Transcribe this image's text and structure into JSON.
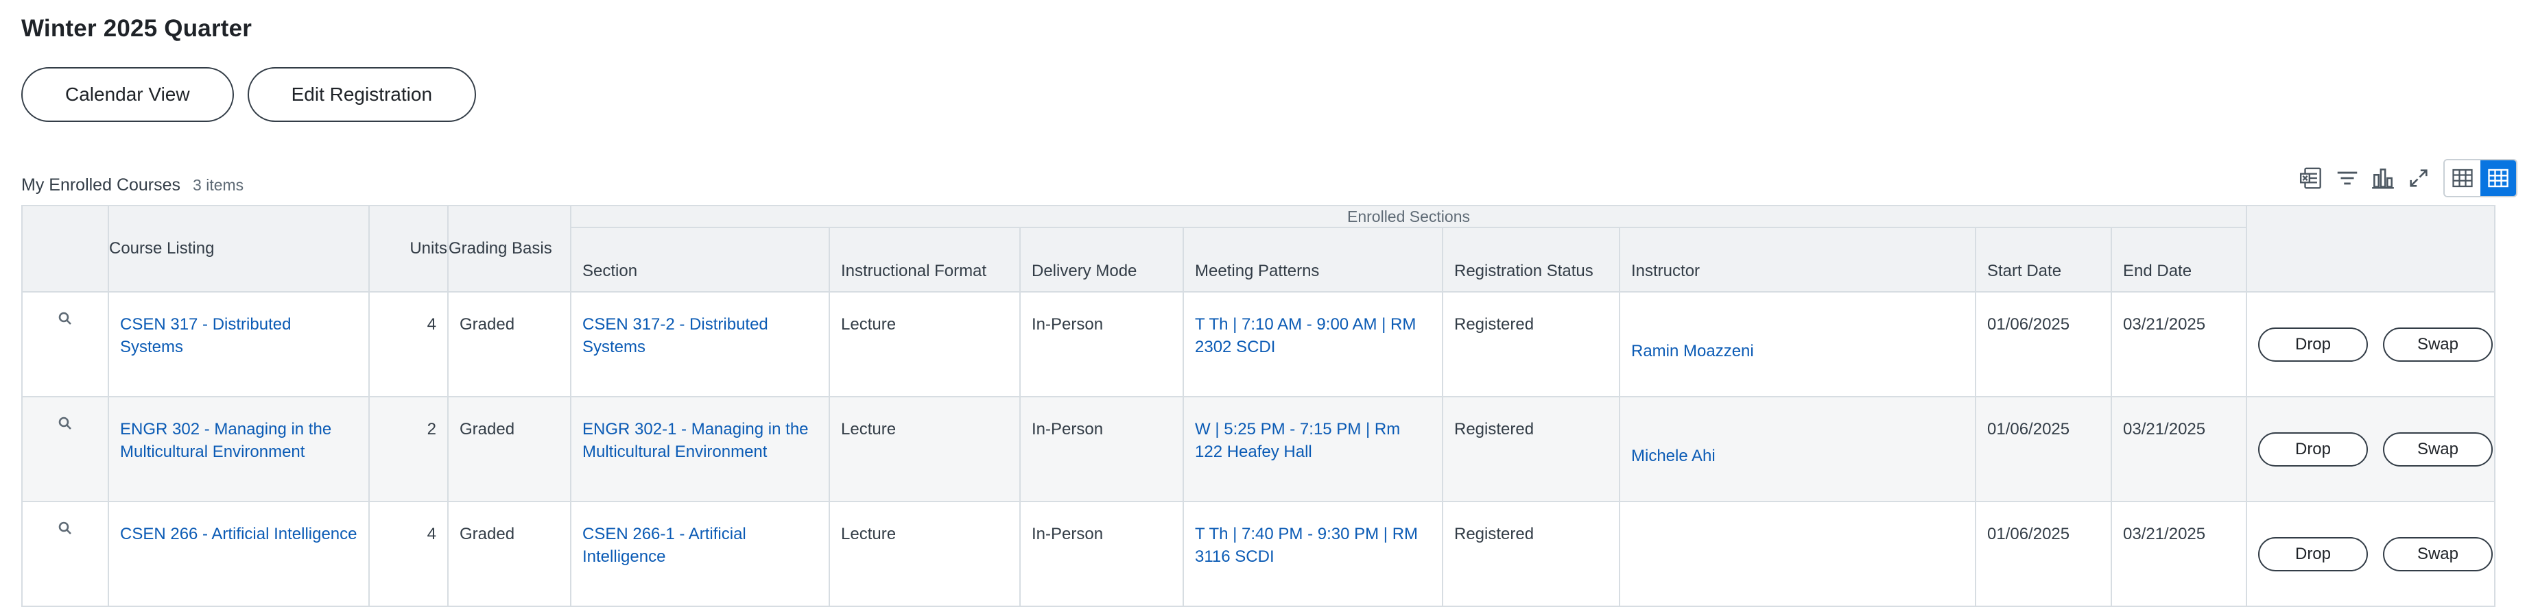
{
  "page": {
    "title": "Winter 2025 Quarter"
  },
  "actions": {
    "calendar_view": "Calendar View",
    "edit_registration": "Edit Registration"
  },
  "grid": {
    "title": "My Enrolled Courses",
    "count": "3 items",
    "group_header": "Enrolled Sections",
    "columns": {
      "course_listing": "Course Listing",
      "units": "Units",
      "grading_basis": "Grading Basis",
      "section": "Section",
      "instructional_format": "Instructional Format",
      "delivery_mode": "Delivery Mode",
      "meeting_patterns": "Meeting Patterns",
      "registration_status": "Registration Status",
      "instructor": "Instructor",
      "start_date": "Start Date",
      "end_date": "End Date"
    },
    "rows": [
      {
        "course_listing": "CSEN 317 - Distributed Systems",
        "units": "4",
        "grading_basis": "Graded",
        "section": "CSEN 317-2 - Distributed Systems",
        "instructional_format": "Lecture",
        "delivery_mode": "In-Person",
        "meeting_patterns": "T Th | 7:10 AM - 9:00 AM | RM 2302 SCDI",
        "registration_status": "Registered",
        "instructor": "Ramin Moazzeni",
        "start_date": "01/06/2025",
        "end_date": "03/21/2025",
        "drop": "Drop",
        "swap": "Swap"
      },
      {
        "course_listing": "ENGR 302 - Managing in the Multicultural Environment",
        "units": "2",
        "grading_basis": "Graded",
        "section": "ENGR 302-1 - Managing in the Multicultural Environment",
        "instructional_format": "Lecture",
        "delivery_mode": "In-Person",
        "meeting_patterns": "W | 5:25 PM - 7:15 PM | Rm 122 Heafey Hall",
        "registration_status": "Registered",
        "instructor": "Michele Ahi",
        "start_date": "01/06/2025",
        "end_date": "03/21/2025",
        "drop": "Drop",
        "swap": "Swap"
      },
      {
        "course_listing": "CSEN 266 - Artificial Intelligence",
        "units": "4",
        "grading_basis": "Graded",
        "section": "CSEN 266-1 - Artificial Intelligence",
        "instructional_format": "Lecture",
        "delivery_mode": "In-Person",
        "meeting_patterns": "T Th | 7:40 PM - 9:30 PM | RM 3116 SCDI",
        "registration_status": "Registered",
        "instructor": "",
        "start_date": "01/06/2025",
        "end_date": "03/21/2025",
        "drop": "Drop",
        "swap": "Swap"
      }
    ]
  },
  "toolbar_icons": [
    "export-excel-icon",
    "filter-icon",
    "chart-icon",
    "fullscreen-icon",
    "table-view-icon",
    "grid-view-icon"
  ],
  "colors": {
    "link": "#0b5bb5",
    "active_toggle": "#0875e1",
    "header_bg": "#f0f2f4",
    "border": "#d7dde2"
  }
}
